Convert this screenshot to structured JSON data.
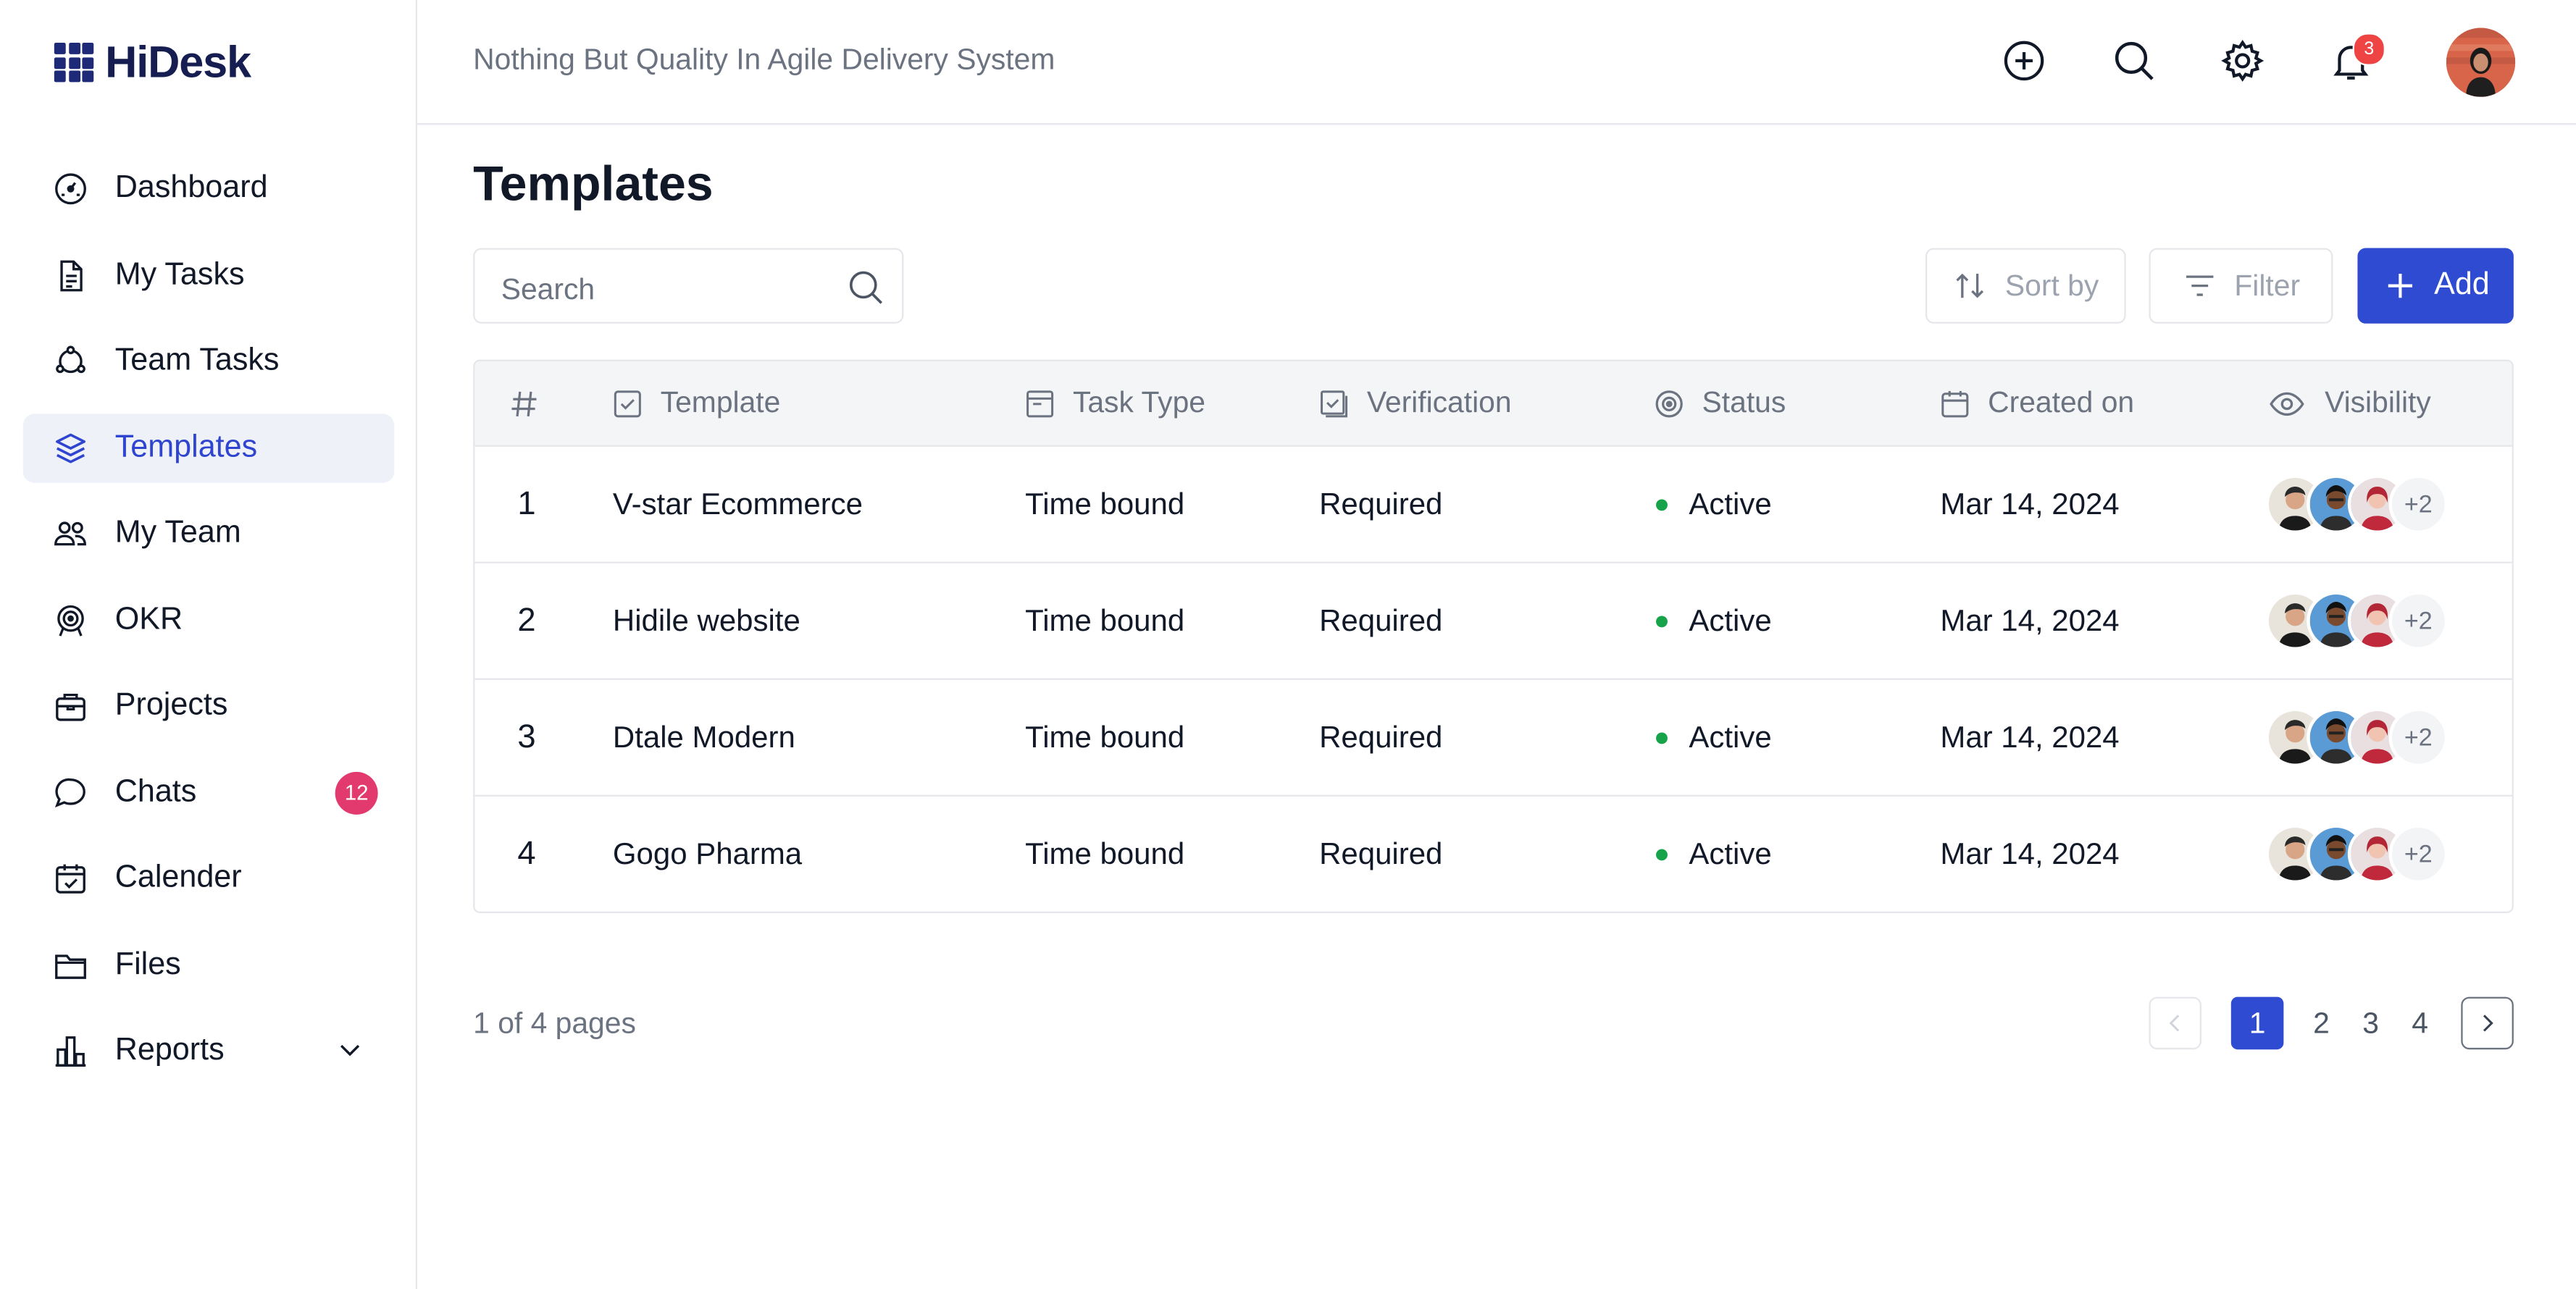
{
  "app": {
    "name": "HiDesk",
    "tagline": "Nothing But Quality In Agile Delivery System",
    "accent": "#2f4bd1",
    "notification_count": "3"
  },
  "sidebar": {
    "items": [
      {
        "label": "Dashboard",
        "icon": "dashboard-gauge-icon"
      },
      {
        "label": "My Tasks",
        "icon": "document-icon"
      },
      {
        "label": "Team Tasks",
        "icon": "team-nodes-icon"
      },
      {
        "label": "Templates",
        "icon": "layers-icon",
        "active": true
      },
      {
        "label": "My Team",
        "icon": "users-icon"
      },
      {
        "label": "OKR",
        "icon": "target-icon"
      },
      {
        "label": "Projects",
        "icon": "briefcase-icon"
      },
      {
        "label": "Chats",
        "icon": "chat-icon",
        "badge": "12"
      },
      {
        "label": "Calender",
        "icon": "calendar-check-icon"
      },
      {
        "label": "Files",
        "icon": "folder-icon"
      },
      {
        "label": "Reports",
        "icon": "bar-chart-icon",
        "expandable": true
      }
    ]
  },
  "main": {
    "title": "Templates",
    "search_placeholder": "Search",
    "sort_label": "Sort by",
    "filter_label": "Filter",
    "add_label": "Add",
    "columns": {
      "number": "#",
      "template": "Template",
      "task_type": "Task Type",
      "verification": "Verification",
      "status": "Status",
      "created_on": "Created on",
      "visibility": "Visibility"
    },
    "rows": [
      {
        "no": "1",
        "template": "V-star Ecommerce",
        "task_type": "Time bound",
        "verification": "Required",
        "status": "Active",
        "created_on": "Mar 14, 2024",
        "more": "+2"
      },
      {
        "no": "2",
        "template": "Hidile website",
        "task_type": "Time bound",
        "verification": "Required",
        "status": "Active",
        "created_on": "Mar 14, 2024",
        "more": "+2"
      },
      {
        "no": "3",
        "template": "Dtale Modern",
        "task_type": "Time bound",
        "verification": "Required",
        "status": "Active",
        "created_on": "Mar 14, 2024",
        "more": "+2"
      },
      {
        "no": "4",
        "template": "Gogo Pharma",
        "task_type": "Time bound",
        "verification": "Required",
        "status": "Active",
        "created_on": "Mar 14, 2024",
        "more": "+2"
      }
    ],
    "pagination": {
      "info": "1 of 4 pages",
      "pages": [
        "1",
        "2",
        "3",
        "4"
      ],
      "current": "1"
    }
  }
}
